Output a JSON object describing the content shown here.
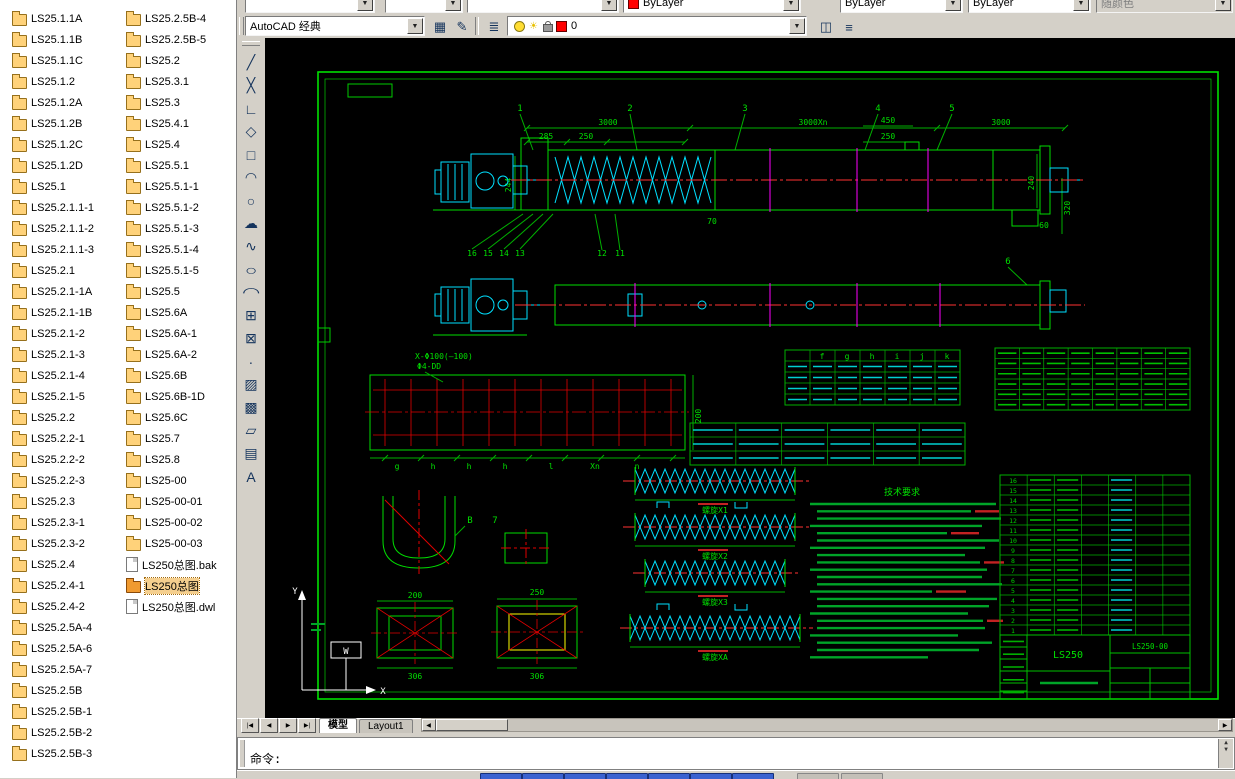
{
  "toolbar_row1": {
    "combos": [
      {
        "name": "style-combo-a",
        "value": ""
      },
      {
        "name": "style-combo-b",
        "value": ""
      },
      {
        "name": "dim-style-combo",
        "value": ""
      },
      {
        "name": "color-combo",
        "value": "ByLayer"
      },
      {
        "name": "linetype-combo",
        "value": "ByLayer"
      },
      {
        "name": "lineweight-combo",
        "value": "ByLayer"
      },
      {
        "name": "plotstyle-combo",
        "value": "随颜色"
      }
    ]
  },
  "toolbar_row2": {
    "workspace_combo_value": "AutoCAD 经典",
    "left_buttons": [
      {
        "name": "sheet-set-manager",
        "glyph": "▦"
      },
      {
        "name": "markup",
        "glyph": "✎"
      }
    ],
    "layers_button_glyph": "≣",
    "layer_combo": {
      "layer_name": "0",
      "freeze_glyph": "☀"
    },
    "right_buttons": [
      {
        "name": "layer-states",
        "glyph": "◫"
      },
      {
        "name": "layer-previous",
        "glyph": "≡"
      }
    ]
  },
  "tool_palette": {
    "tools": [
      {
        "name": "line",
        "glyph": "╱"
      },
      {
        "name": "construction-line",
        "glyph": "╳"
      },
      {
        "name": "polyline",
        "glyph": "∟"
      },
      {
        "name": "polygon",
        "glyph": "◇"
      },
      {
        "name": "rectangle",
        "glyph": "□"
      },
      {
        "name": "arc",
        "glyph": "◠"
      },
      {
        "name": "circle",
        "glyph": "○"
      },
      {
        "name": "revision-cloud",
        "glyph": "☁"
      },
      {
        "name": "spline",
        "glyph": "∿"
      },
      {
        "name": "ellipse",
        "glyph": "○",
        "mod": "wide"
      },
      {
        "name": "ellipse-arc",
        "glyph": "◠",
        "mod": "wide"
      },
      {
        "name": "insert-block",
        "glyph": "⊞"
      },
      {
        "name": "make-block",
        "glyph": "⊠"
      },
      {
        "name": "point",
        "glyph": "∙"
      },
      {
        "name": "hatch",
        "glyph": "▨"
      },
      {
        "name": "gradient",
        "glyph": "▩"
      },
      {
        "name": "region",
        "glyph": "▱"
      },
      {
        "name": "table",
        "glyph": "▤"
      },
      {
        "name": "multiline-text",
        "glyph": "A"
      }
    ]
  },
  "file_panel": {
    "columns": [
      {
        "items": [
          {
            "label": "LS25.1.1A"
          },
          {
            "label": "LS25.1.1B"
          },
          {
            "label": "LS25.1.1C"
          },
          {
            "label": "LS25.1.2"
          },
          {
            "label": "LS25.1.2A"
          },
          {
            "label": "LS25.1.2B"
          },
          {
            "label": "LS25.1.2C"
          },
          {
            "label": "LS25.1.2D"
          },
          {
            "label": "LS25.1"
          },
          {
            "label": "LS25.2.1.1-1"
          },
          {
            "label": "LS25.2.1.1-2"
          },
          {
            "label": "LS25.2.1.1-3"
          },
          {
            "label": "LS25.2.1"
          },
          {
            "label": "LS25.2.1-1A"
          },
          {
            "label": "LS25.2.1-1B"
          },
          {
            "label": "LS25.2.1-2"
          },
          {
            "label": "LS25.2.1-3"
          },
          {
            "label": "LS25.2.1-4"
          },
          {
            "label": "LS25.2.1-5"
          },
          {
            "label": "LS25.2.2"
          },
          {
            "label": "LS25.2.2-1"
          },
          {
            "label": "LS25.2.2-2"
          },
          {
            "label": "LS25.2.2-3"
          },
          {
            "label": "LS25.2.3"
          },
          {
            "label": "LS25.2.3-1"
          },
          {
            "label": "LS25.2.3-2"
          },
          {
            "label": "LS25.2.4"
          },
          {
            "label": "LS25.2.4-1"
          },
          {
            "label": "LS25.2.4-2"
          },
          {
            "label": "LS25.2.5A-4"
          },
          {
            "label": "LS25.2.5A-6"
          },
          {
            "label": "LS25.2.5A-7"
          },
          {
            "label": "LS25.2.5B"
          },
          {
            "label": "LS25.2.5B-1"
          },
          {
            "label": "LS25.2.5B-2"
          },
          {
            "label": "LS25.2.5B-3"
          }
        ]
      },
      {
        "items": [
          {
            "label": "LS25.2.5B-4"
          },
          {
            "label": "LS25.2.5B-5"
          },
          {
            "label": "LS25.2"
          },
          {
            "label": "LS25.3.1"
          },
          {
            "label": "LS25.3"
          },
          {
            "label": "LS25.4.1"
          },
          {
            "label": "LS25.4"
          },
          {
            "label": "LS25.5.1"
          },
          {
            "label": "LS25.5.1-1"
          },
          {
            "label": "LS25.5.1-2"
          },
          {
            "label": "LS25.5.1-3"
          },
          {
            "label": "LS25.5.1-4"
          },
          {
            "label": "LS25.5.1-5"
          },
          {
            "label": "LS25.5"
          },
          {
            "label": "LS25.6A"
          },
          {
            "label": "LS25.6A-1"
          },
          {
            "label": "LS25.6A-2"
          },
          {
            "label": "LS25.6B"
          },
          {
            "label": "LS25.6B-1D"
          },
          {
            "label": "LS25.6C"
          },
          {
            "label": "LS25.7"
          },
          {
            "label": "LS25.8"
          },
          {
            "label": "LS25-00"
          },
          {
            "label": "LS25-00-01"
          },
          {
            "label": "LS25-00-02"
          },
          {
            "label": "LS25-00-03"
          },
          {
            "label": "LS250总图.bak",
            "type": "file"
          },
          {
            "label": "LS250总图",
            "selected": true
          },
          {
            "label": "LS250总图.dwl",
            "type": "file"
          }
        ]
      }
    ]
  },
  "tabs": {
    "nav": [
      "|◀",
      "◀",
      "▶",
      "▶|"
    ],
    "model": "模型",
    "layout": "Layout1"
  },
  "command": {
    "prompt": "命令:"
  },
  "drawing": {
    "balloons": {
      "b1": "1",
      "b2": "2",
      "b3": "3",
      "b4": "4",
      "b5": "5",
      "b6": "6"
    },
    "dims": {
      "d3000a": "3000",
      "d3000xn": "3000Xn",
      "d3000b": "3000",
      "d285": "285",
      "d250a": "250",
      "d450": "450",
      "d250b": "250",
      "d240": "240",
      "d320": "320",
      "d244": "244",
      "d60": "60",
      "d70": "70",
      "d200rot": "200",
      "flange_note1": "X-Φ100(—100)",
      "flange_note2": "Φ4-DD",
      "sq1_top": "200",
      "sq1_bottom": "306",
      "sq2_top": "250",
      "sq2_bottom": "306"
    },
    "leader_numbers": {
      "n16": "16",
      "n15": "15",
      "n14": "14",
      "n13": "13",
      "n12": "12",
      "n11": "11"
    },
    "flange_letters": {
      "g": "g",
      "h1": "h",
      "h2": "h",
      "h3": "h",
      "l": "l",
      "xn": "Xn",
      "n": "n"
    },
    "table_a_headers": [
      "f",
      "g",
      "h",
      "i",
      "j",
      "k"
    ],
    "notes_title": "技术要求",
    "screw_labels": [
      "螺旋X1",
      "螺旋X2",
      "螺旋X3",
      "螺旋XA"
    ],
    "section_labels": {
      "b": "B",
      "part7": "7"
    },
    "ucs": {
      "x": "X",
      "y": "Y",
      "w": "W"
    },
    "title_block": {
      "model": "LS250",
      "drawing_no": "LS250-00"
    },
    "bom_item_numbers": [
      "16",
      "15",
      "14",
      "13",
      "12",
      "11",
      "10",
      "9",
      "8",
      "7",
      "6",
      "5",
      "4",
      "3",
      "2",
      "1"
    ]
  }
}
